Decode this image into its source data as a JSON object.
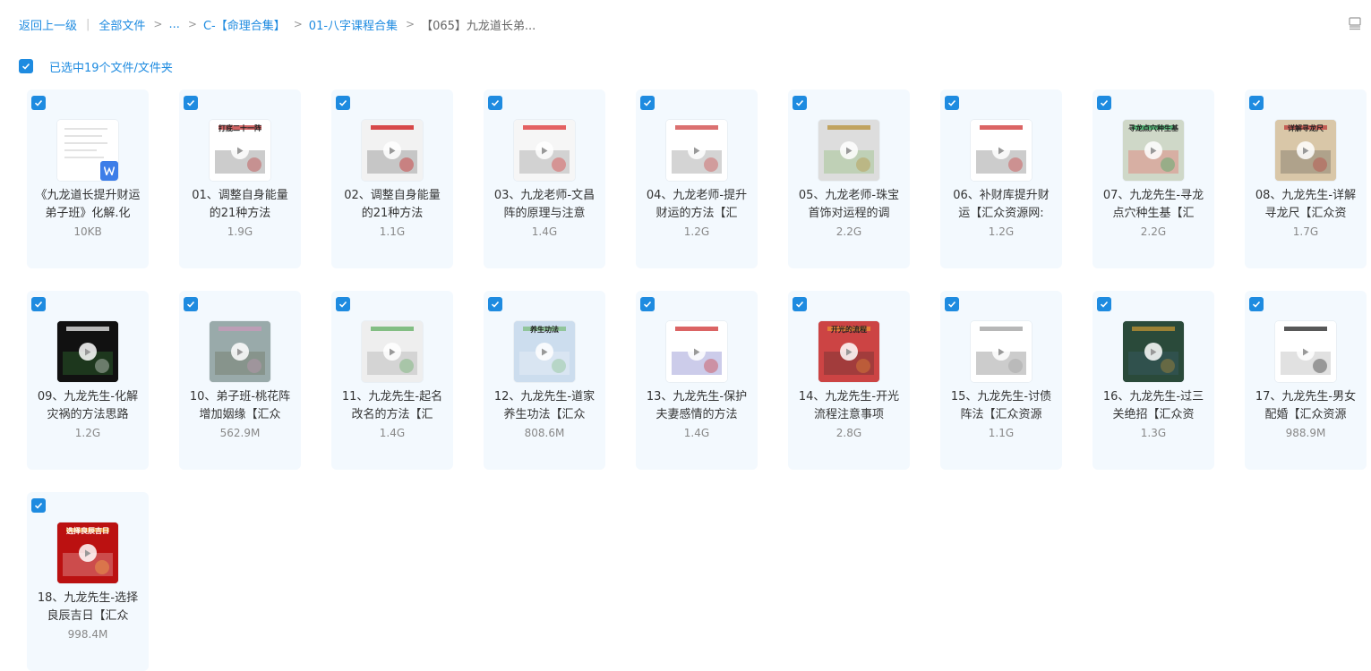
{
  "breadcrumb": {
    "back": "返回上一级",
    "all_files": "全部文件",
    "ellipsis": "...",
    "folder1": "C-【命理合集】",
    "folder2": "01-八字课程合集",
    "current": "【065】九龙道长弟..."
  },
  "selection": {
    "label": "已选中19个文件/文件夹"
  },
  "colors": {
    "accent": "#1e8be0",
    "card_bg": "#f3f9fe"
  },
  "files": [
    {
      "name": "《九龙道长提升财运弟子班》化解.化",
      "size": "10KB",
      "type": "doc",
      "thumb_text": ""
    },
    {
      "name": "01、调整自身能量的21种方法",
      "size": "1.9G",
      "type": "video",
      "thumb_text": "打底二十一阵"
    },
    {
      "name": "02、调整自身能量的21种方法",
      "size": "1.1G",
      "type": "video",
      "thumb_text": ""
    },
    {
      "name": "03、九龙老师-文昌阵的原理与注意",
      "size": "1.4G",
      "type": "video",
      "thumb_text": ""
    },
    {
      "name": "04、九龙老师-提升财运的方法【汇",
      "size": "1.2G",
      "type": "video",
      "thumb_text": ""
    },
    {
      "name": "05、九龙老师-珠宝首饰对运程的调",
      "size": "2.2G",
      "type": "video",
      "thumb_text": ""
    },
    {
      "name": "06、补财库提升财运【汇众资源网:",
      "size": "1.2G",
      "type": "video",
      "thumb_text": ""
    },
    {
      "name": "07、九龙先生-寻龙点穴种生基【汇",
      "size": "2.2G",
      "type": "video",
      "thumb_text": "寻龙点穴种生基"
    },
    {
      "name": "08、九龙先生-详解寻龙尺【汇众资",
      "size": "1.7G",
      "type": "video",
      "thumb_text": "详解寻龙尺"
    },
    {
      "name": "09、九龙先生-化解灾祸的方法思路",
      "size": "1.2G",
      "type": "video",
      "thumb_text": ""
    },
    {
      "name": "10、弟子班-桃花阵增加姻缘【汇众",
      "size": "562.9M",
      "type": "video",
      "thumb_text": ""
    },
    {
      "name": "11、九龙先生-起名改名的方法【汇",
      "size": "1.4G",
      "type": "video",
      "thumb_text": ""
    },
    {
      "name": "12、九龙先生-道家养生功法【汇众",
      "size": "808.6M",
      "type": "video",
      "thumb_text": "养生功法"
    },
    {
      "name": "13、九龙先生-保护夫妻感情的方法",
      "size": "1.4G",
      "type": "video",
      "thumb_text": ""
    },
    {
      "name": "14、九龙先生-开光流程注意事项",
      "size": "2.8G",
      "type": "video",
      "thumb_text": "开光的流程"
    },
    {
      "name": "15、九龙先生-讨债阵法【汇众资源",
      "size": "1.1G",
      "type": "video",
      "thumb_text": ""
    },
    {
      "name": "16、九龙先生-过三关绝招【汇众资",
      "size": "1.3G",
      "type": "video",
      "thumb_text": ""
    },
    {
      "name": "17、九龙先生-男女配婚【汇众资源",
      "size": "988.9M",
      "type": "video",
      "thumb_text": ""
    },
    {
      "name": "18、九龙先生-选择良辰吉日【汇众",
      "size": "998.4M",
      "type": "video",
      "thumb_text": "选择良辰吉日"
    }
  ]
}
